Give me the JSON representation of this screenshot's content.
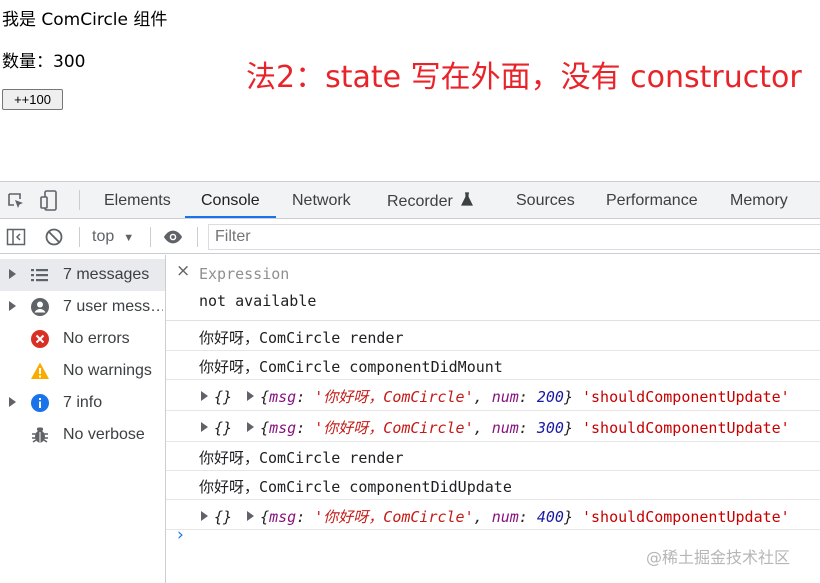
{
  "app": {
    "title_line": "我是 ComCircle 组件",
    "count_line": "数量：300",
    "increment_button": "++100"
  },
  "annotation": "法2：state 写在外面，没有 constructor",
  "devtools": {
    "tabs": [
      "Elements",
      "Console",
      "Network",
      "Recorder",
      "Sources",
      "Performance",
      "Memory"
    ],
    "active_tab": "Console",
    "toolbar": {
      "context": "top",
      "filter_placeholder": "Filter"
    },
    "sidebar": [
      {
        "label": "7 messages",
        "icon": "list-icon",
        "expandable": true,
        "selected": true
      },
      {
        "label": "7 user mess…",
        "icon": "user-icon",
        "expandable": true,
        "selected": false
      },
      {
        "label": "No errors",
        "icon": "error-icon",
        "expandable": false,
        "selected": false
      },
      {
        "label": "No warnings",
        "icon": "warning-icon",
        "expandable": false,
        "selected": false
      },
      {
        "label": "7 info",
        "icon": "info-icon",
        "expandable": true,
        "selected": false
      },
      {
        "label": "No verbose",
        "icon": "bug-icon",
        "expandable": false,
        "selected": false
      }
    ],
    "expression": {
      "label": "Expression",
      "value": "not available"
    },
    "messages": [
      {
        "type": "text",
        "text": "你好呀，ComCircle render"
      },
      {
        "type": "text",
        "text": "你好呀，ComCircle componentDidMount"
      },
      {
        "type": "object",
        "msg": "'你好呀，ComCircle'",
        "num": "200",
        "suffix": "'shouldComponentUpdate'"
      },
      {
        "type": "object",
        "msg": "'你好呀，ComCircle'",
        "num": "300",
        "suffix": "'shouldComponentUpdate'"
      },
      {
        "type": "text",
        "text": "你好呀，ComCircle render"
      },
      {
        "type": "text",
        "text": "你好呀，ComCircle componentDidUpdate"
      },
      {
        "type": "object",
        "msg": "'你好呀，ComCircle'",
        "num": "400",
        "suffix": "'shouldComponentUpdate'"
      }
    ],
    "object_labels": {
      "empty": "{}",
      "open": "{",
      "msg_key": "msg",
      "num_key": "num",
      "close": "}"
    },
    "prompt_symbol": "›"
  },
  "watermark": "@稀土掘金技术社区",
  "colors": {
    "annotation": "#e8242a",
    "active_tab_underline": "#1a73e8",
    "error": "#d93025",
    "warning": "#f9ab00",
    "info": "#1a73e8"
  }
}
